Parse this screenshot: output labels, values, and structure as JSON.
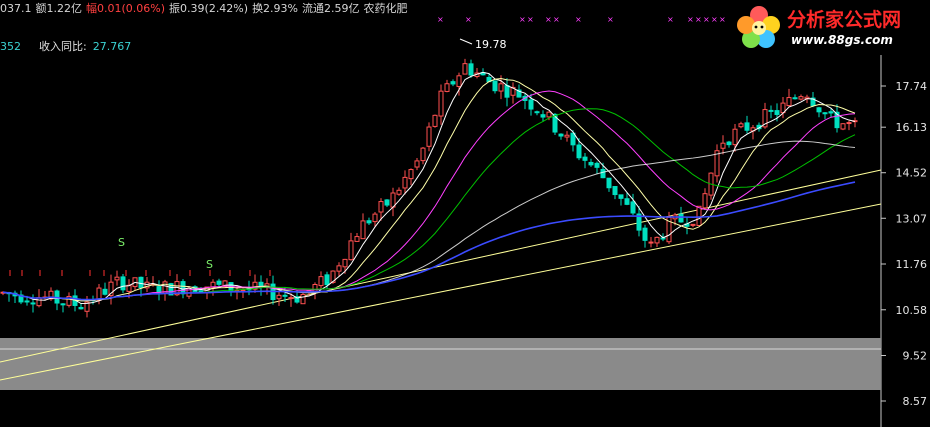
{
  "header": {
    "items": [
      {
        "label": "037.1",
        "color": "#d6d6d6"
      },
      {
        "label": "额1.22亿",
        "color": "#d6d6d6"
      },
      {
        "label": "幅",
        "color": "#ff4040"
      },
      {
        "label": "0.01(0.06%)",
        "color": "#ff4040"
      },
      {
        "label": "振0.39(2.42%)",
        "color": "#d6d6d6"
      },
      {
        "label": "换2.93%",
        "color": "#d6d6d6"
      },
      {
        "label": "流通2.59亿",
        "color": "#d6d6d6"
      },
      {
        "label": "农药化肥",
        "color": "#d6d6d6"
      }
    ]
  },
  "indicator": {
    "left_value": "352",
    "name": "收入同比:",
    "value": "27.767",
    "value_color": "#3bd3d3"
  },
  "logo": {
    "title": "分析家公式网",
    "url": "www.88gs.com"
  },
  "chart_data": {
    "type": "candlestick",
    "y_ticks": [
      "17.74",
      "16.13",
      "14.52",
      "13.07",
      "11.76",
      "10.58",
      "9.52",
      "8.57"
    ],
    "ylim": [
      8.57,
      19.78
    ],
    "peak_label": "19.78",
    "signal_labels": [
      "S",
      "S"
    ],
    "ma_colors": {
      "ma5": "#ffffff",
      "ma10": "#ffffaa",
      "ma20": "#ff40ff",
      "ma30": "#00c000",
      "ma60": "#ffffff",
      "ma120": "#3b4bff"
    },
    "trendline_color": "#ffff99",
    "up_color": "#ff5050",
    "down_color": "#00e0c0"
  }
}
